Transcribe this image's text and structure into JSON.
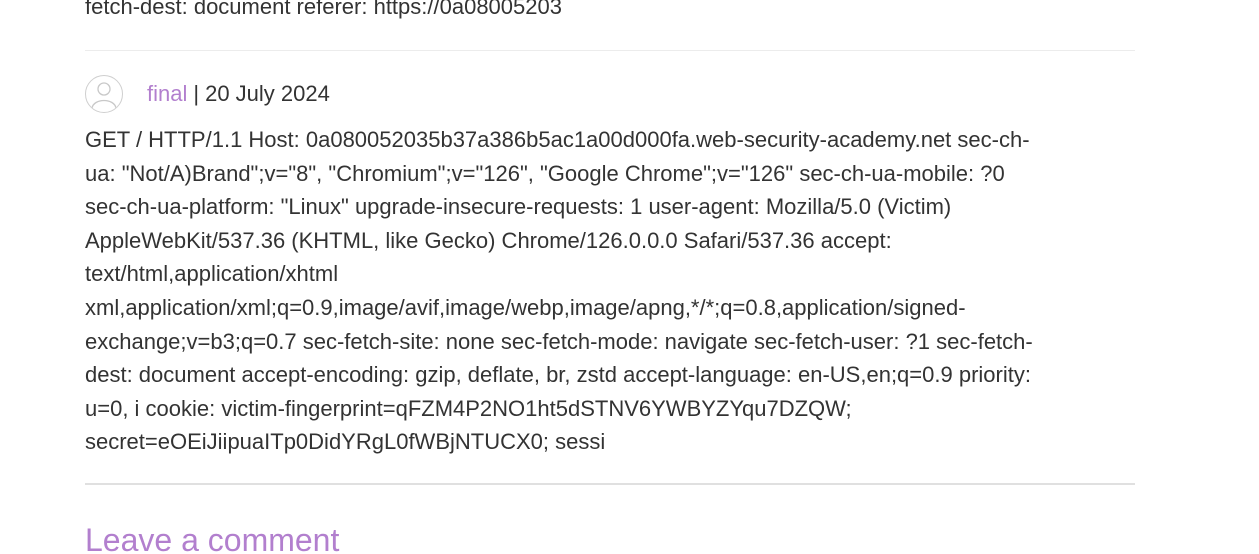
{
  "previous_comment": {
    "tail_text": "fetch-dest: document referer: https://0a08005203"
  },
  "comment": {
    "author": "final",
    "separator": "|",
    "date": "20 July 2024",
    "lines": [
      "GET / HTTP/1.1 Host: 0a080052035b37a386b5ac1a00d000fa.web-security-academy.net sec-ch-",
      "ua: \"Not/A)Brand\";v=\"8\", \"Chromium\";v=\"126\", \"Google Chrome\";v=\"126\" sec-ch-ua-mobile: ?0",
      "sec-ch-ua-platform: \"Linux\" upgrade-insecure-requests: 1 user-agent: Mozilla/5.0 (Victim)",
      "AppleWebKit/537.36 (KHTML, like Gecko) Chrome/126.0.0.0 Safari/537.36 accept:",
      "text/html,application/xhtml",
      "xml,application/xml;q=0.9,image/avif,image/webp,image/apng,*/*;q=0.8,application/signed-",
      "exchange;v=b3;q=0.7 sec-fetch-site: none sec-fetch-mode: navigate sec-fetch-user: ?1 sec-fetch-",
      "dest: document accept-encoding: gzip, deflate, br, zstd accept-language: en-US,en;q=0.9 priority:",
      "u=0, i cookie: victim-fingerprint=qFZM4P2NO1ht5dSTNV6YWBYZYqu7DZQW;",
      "secret=eOEiJiipuaITp0DidYRgL0fWBjNTUCX0; sessi"
    ]
  },
  "leave_comment": {
    "title": "Leave a comment"
  },
  "colors": {
    "accent": "#b27fce",
    "text": "#333333",
    "divider": "#e0e0e0"
  }
}
